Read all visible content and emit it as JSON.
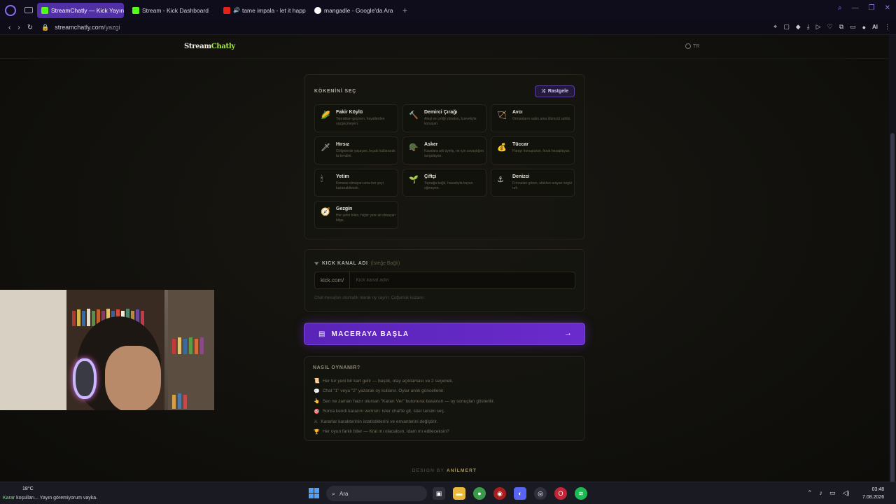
{
  "browser": {
    "tabs": [
      {
        "label": "StreamChatly — Kick Yayın",
        "active": true,
        "favicon": "streamchatly"
      },
      {
        "label": "Stream - Kick Dashboard",
        "active": false,
        "favicon": "kick"
      },
      {
        "label": "tame impala - let it happ",
        "active": false,
        "favicon": "youtube",
        "audio": true
      },
      {
        "label": "mangadle - Google'da Ara",
        "active": false,
        "favicon": "google"
      }
    ],
    "new_tab": "+",
    "url_domain": "streamchatly.com",
    "url_path": "/yazgi",
    "ai_label": "AI"
  },
  "page": {
    "brand_main": "Stream",
    "brand_accent": "Chatly",
    "lang": "TR",
    "origin": {
      "title": "KÖKENİNİ SEÇ",
      "random_label": "Rastgele",
      "items": [
        {
          "name": "Fakir Köylü",
          "desc": "Topraktan geçinen, hayallerden vazgeçmeyen.",
          "icon": "🌽"
        },
        {
          "name": "Demirci Çırağı",
          "desc": "Ateşi ve çeliği yöneten, kuvvetiyle konuşan.",
          "icon": "🔨"
        },
        {
          "name": "Avcı",
          "desc": "Ormanların sakin ama ölümcül sahibi.",
          "icon": "🏹"
        },
        {
          "name": "Hırsız",
          "desc": "Gölgelerde yaşayan, bıçakı kullanarak ta kendini.",
          "icon": "🗡"
        },
        {
          "name": "Asker",
          "desc": "Kaoslara arti üyeliş, ne için savaştığını sorgulayan.",
          "icon": "🪖"
        },
        {
          "name": "Tüccar",
          "desc": "Parayı konuşturan, fırsat hesaplayan.",
          "icon": "💰"
        },
        {
          "name": "Yetim",
          "desc": "Kimsesi olmayan ama her şeyi kazanabilecek.",
          "icon": "🕯"
        },
        {
          "name": "Çiftçi",
          "desc": "Toprağa bağlı, hasadıyla boyun eğmeyen.",
          "icon": "🌱"
        },
        {
          "name": "Denizci",
          "desc": "Fırtınaları gören, ufukları arayan özgür ruh.",
          "icon": "⚓"
        },
        {
          "name": "Gezgin",
          "desc": "Her şehri bilen, hiçbir yere ait olmayan bilge.",
          "icon": "🧭"
        }
      ]
    },
    "kick": {
      "title": "KICK KANAL ADI",
      "optional": "(İsteğe Bağlı)",
      "prefix": "kick.com/",
      "placeholder": "Kick kanal adın",
      "hint": "Chat mesajları otomatik olarak oy sayılır. Çoğunluk kazanır."
    },
    "start_label": "MACERAYA BAŞLA",
    "how": {
      "title": "NASIL OYNANIR?",
      "items": [
        {
          "icon": "📜",
          "text": "Her tur yeni bir kart gelir — başlık, olay açıklaması ve 2 seçenek."
        },
        {
          "icon": "💬",
          "text": "Chat \"1\" veya \"2\" yazarak oy kullanır. Oylar anlık güncellenir."
        },
        {
          "icon": "👆",
          "text": "Sen ne zaman hazır olursan \"Kararı Ver\" butonuna basarsın — oy sonuçları gösterilir."
        },
        {
          "icon": "🎯",
          "text": "Sonra kendi kararını verirsin: ister chat'le git, ister tersini seç."
        },
        {
          "icon": "⚔",
          "text": "Kararlar karakterinin istatistiklerini ve envanterini değiştirir."
        },
        {
          "icon": "🏆",
          "text": "Her oyun farklı biter — Kral mı olacaksın, idam mı edileceksin?"
        }
      ]
    },
    "credit_prefix": "DESIGN BY",
    "credit_author": "ANİLMERT"
  },
  "taskbar": {
    "weather": "18°C",
    "ticker_highlight": "Karar",
    "ticker_rest": "koşulları... Yayın göremiyorum vayka.",
    "search_placeholder": "Ara",
    "time": "03:48",
    "date": "7.08.2026"
  },
  "colors": {
    "accent_purple": "#6a2bcc",
    "brand_green": "#a6e34a",
    "credit_gold": "#b39a52"
  }
}
